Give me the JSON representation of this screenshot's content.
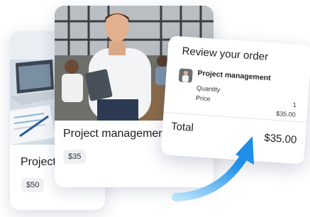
{
  "cards": [
    {
      "title": "Project management",
      "price": "$50"
    },
    {
      "title": "Project management",
      "price": "$35"
    }
  ],
  "order": {
    "title": "Review your order",
    "item_name": "Project management",
    "quantity_label": "Quantity",
    "quantity_value": "1",
    "price_label": "Price",
    "price_value": "$35.00",
    "total_label": "Total",
    "total_value": "$35.00"
  },
  "colors": {
    "arrow_top": "#1f8fe8",
    "arrow_bottom": "#b8e3fb"
  }
}
